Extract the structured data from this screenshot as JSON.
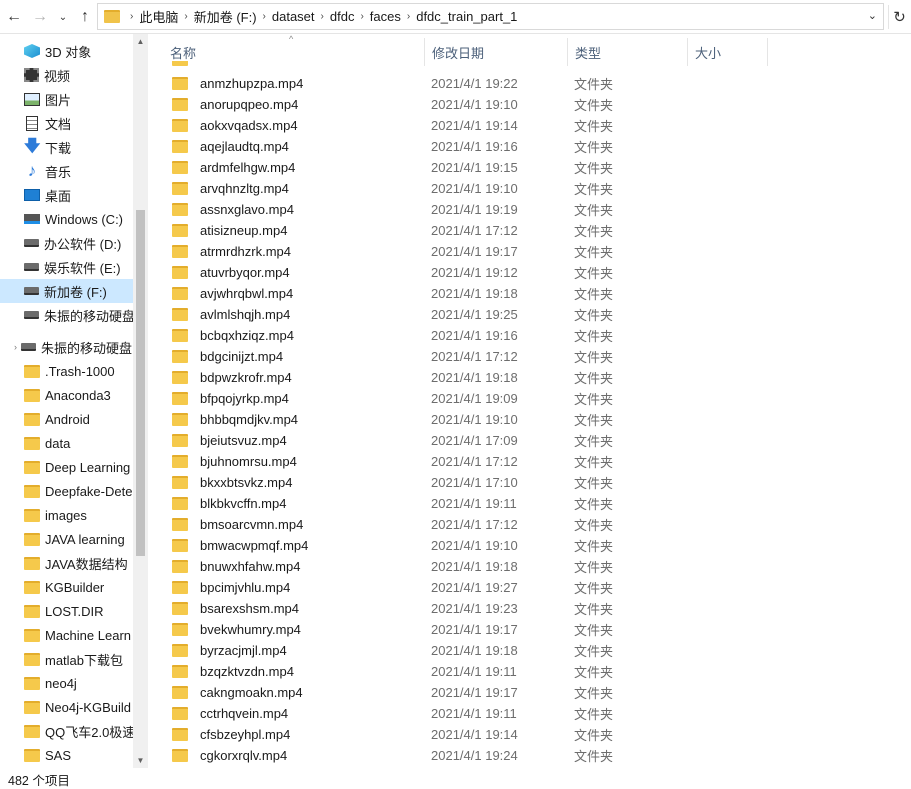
{
  "nav": {
    "back_icon": "←",
    "forward_icon": "→",
    "recent_icon": "⌄",
    "up_icon": "↑",
    "refresh_icon": "↻",
    "dropdown_icon": "⌄"
  },
  "breadcrumb": [
    "此电脑",
    "新加卷 (F:)",
    "dataset",
    "dfdc",
    "faces",
    "dfdc_train_part_1"
  ],
  "sidebar": {
    "items": [
      {
        "label": "3D 对象",
        "icon": "3d-objects-icon"
      },
      {
        "label": "视频",
        "icon": "video-icon"
      },
      {
        "label": "图片",
        "icon": "pictures-icon"
      },
      {
        "label": "文档",
        "icon": "documents-icon"
      },
      {
        "label": "下载",
        "icon": "download-icon"
      },
      {
        "label": "音乐",
        "icon": "music-icon"
      },
      {
        "label": "桌面",
        "icon": "desktop-icon"
      },
      {
        "label": "Windows (C:)",
        "icon": "windows-drive-icon"
      },
      {
        "label": "办公软件 (D:)",
        "icon": "drive-icon"
      },
      {
        "label": "娱乐软件 (E:)",
        "icon": "drive-icon"
      },
      {
        "label": "新加卷 (F:)",
        "icon": "drive-icon",
        "selected": true
      },
      {
        "label": "朱振的移动硬盘",
        "icon": "drive-icon"
      },
      {
        "label": "朱振的移动硬盘 (",
        "icon": "drive-icon",
        "expander": "›"
      },
      {
        "label": ".Trash-1000",
        "icon": "folder-icon"
      },
      {
        "label": "Anaconda3",
        "icon": "folder-icon"
      },
      {
        "label": "Android",
        "icon": "folder-icon"
      },
      {
        "label": "data",
        "icon": "folder-icon"
      },
      {
        "label": "Deep Learning",
        "icon": "folder-icon"
      },
      {
        "label": "Deepfake-Dete",
        "icon": "folder-icon"
      },
      {
        "label": "images",
        "icon": "folder-icon"
      },
      {
        "label": "JAVA learning",
        "icon": "folder-icon"
      },
      {
        "label": "JAVA数据结构",
        "icon": "folder-icon"
      },
      {
        "label": "KGBuilder",
        "icon": "folder-icon"
      },
      {
        "label": "LOST.DIR",
        "icon": "folder-icon"
      },
      {
        "label": "Machine Learn",
        "icon": "folder-icon"
      },
      {
        "label": "matlab下载包",
        "icon": "folder-icon"
      },
      {
        "label": "neo4j",
        "icon": "folder-icon"
      },
      {
        "label": "Neo4j-KGBuild",
        "icon": "folder-icon"
      },
      {
        "label": "QQ飞车2.0极速",
        "icon": "folder-icon"
      },
      {
        "label": "SAS",
        "icon": "folder-icon"
      }
    ]
  },
  "columns": {
    "name": "名称",
    "modified": "修改日期",
    "type": "类型",
    "size": "大小"
  },
  "sort_icon": "^",
  "files": [
    {
      "name": "anmzhupzpa.mp4",
      "date": "2021/4/1 19:22",
      "type": "文件夹"
    },
    {
      "name": "anorupqpeo.mp4",
      "date": "2021/4/1 19:10",
      "type": "文件夹"
    },
    {
      "name": "aokxvqadsx.mp4",
      "date": "2021/4/1 19:14",
      "type": "文件夹"
    },
    {
      "name": "aqejlaudtq.mp4",
      "date": "2021/4/1 19:16",
      "type": "文件夹"
    },
    {
      "name": "ardmfelhgw.mp4",
      "date": "2021/4/1 19:15",
      "type": "文件夹"
    },
    {
      "name": "arvqhnzltg.mp4",
      "date": "2021/4/1 19:10",
      "type": "文件夹"
    },
    {
      "name": "assnxglavo.mp4",
      "date": "2021/4/1 19:19",
      "type": "文件夹"
    },
    {
      "name": "atisizneup.mp4",
      "date": "2021/4/1 17:12",
      "type": "文件夹"
    },
    {
      "name": "atrmrdhzrk.mp4",
      "date": "2021/4/1 19:17",
      "type": "文件夹"
    },
    {
      "name": "atuvrbyqor.mp4",
      "date": "2021/4/1 19:12",
      "type": "文件夹"
    },
    {
      "name": "avjwhrqbwl.mp4",
      "date": "2021/4/1 19:18",
      "type": "文件夹"
    },
    {
      "name": "avlmlshqjh.mp4",
      "date": "2021/4/1 19:25",
      "type": "文件夹"
    },
    {
      "name": "bcbqxhziqz.mp4",
      "date": "2021/4/1 19:16",
      "type": "文件夹"
    },
    {
      "name": "bdgcinijzt.mp4",
      "date": "2021/4/1 17:12",
      "type": "文件夹"
    },
    {
      "name": "bdpwzkrofr.mp4",
      "date": "2021/4/1 19:18",
      "type": "文件夹"
    },
    {
      "name": "bfpqojyrkp.mp4",
      "date": "2021/4/1 19:09",
      "type": "文件夹"
    },
    {
      "name": "bhbbqmdjkv.mp4",
      "date": "2021/4/1 19:10",
      "type": "文件夹"
    },
    {
      "name": "bjeiutsvuz.mp4",
      "date": "2021/4/1 17:09",
      "type": "文件夹"
    },
    {
      "name": "bjuhnomrsu.mp4",
      "date": "2021/4/1 17:12",
      "type": "文件夹"
    },
    {
      "name": "bkxxbtsvkz.mp4",
      "date": "2021/4/1 17:10",
      "type": "文件夹"
    },
    {
      "name": "blkbkvcffn.mp4",
      "date": "2021/4/1 19:11",
      "type": "文件夹"
    },
    {
      "name": "bmsoarcvmn.mp4",
      "date": "2021/4/1 17:12",
      "type": "文件夹"
    },
    {
      "name": "bmwacwpmqf.mp4",
      "date": "2021/4/1 19:10",
      "type": "文件夹"
    },
    {
      "name": "bnuwxhfahw.mp4",
      "date": "2021/4/1 19:18",
      "type": "文件夹"
    },
    {
      "name": "bpcimjvhlu.mp4",
      "date": "2021/4/1 19:27",
      "type": "文件夹"
    },
    {
      "name": "bsarexshsm.mp4",
      "date": "2021/4/1 19:23",
      "type": "文件夹"
    },
    {
      "name": "bvekwhumry.mp4",
      "date": "2021/4/1 19:17",
      "type": "文件夹"
    },
    {
      "name": "byrzacjmjl.mp4",
      "date": "2021/4/1 19:18",
      "type": "文件夹"
    },
    {
      "name": "bzqzktvzdn.mp4",
      "date": "2021/4/1 19:11",
      "type": "文件夹"
    },
    {
      "name": "cakngmoakn.mp4",
      "date": "2021/4/1 19:17",
      "type": "文件夹"
    },
    {
      "name": "cctrhqvein.mp4",
      "date": "2021/4/1 19:11",
      "type": "文件夹"
    },
    {
      "name": "cfsbzeyhpl.mp4",
      "date": "2021/4/1 19:14",
      "type": "文件夹"
    },
    {
      "name": "cgkorxrqlv.mp4",
      "date": "2021/4/1 19:24",
      "type": "文件夹"
    }
  ],
  "status": {
    "item_count": "482 个项目"
  },
  "scroll_icons": {
    "up": "▲",
    "down": "▼"
  },
  "colors": {
    "selected": "#cce8ff",
    "folder": "#f5c94b",
    "header_text": "#4c607a"
  }
}
